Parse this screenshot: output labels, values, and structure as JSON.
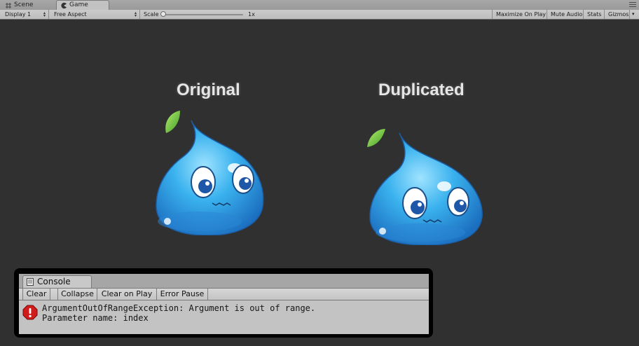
{
  "tabs": [
    {
      "label": "Scene",
      "icon": "grid-icon"
    },
    {
      "label": "Game",
      "icon": "pacman-icon",
      "active": true
    }
  ],
  "toolbar": {
    "display": "Display 1",
    "aspect": "Free Aspect",
    "scale_label": "Scale",
    "scale_value": "1x",
    "maximize_on_play": "Maximize On Play",
    "mute_audio": "Mute Audio",
    "stats": "Stats",
    "gizmos": "Gizmos"
  },
  "game": {
    "original_label": "Original",
    "duplicated_label": "Duplicated"
  },
  "console": {
    "tab_label": "Console",
    "buttons": [
      "Clear",
      "Collapse",
      "Clear on Play",
      "Error Pause"
    ],
    "error": {
      "line1": "ArgumentOutOfRangeException: Argument is out of range.",
      "line2": "Parameter name: index",
      "icon": "error-icon"
    }
  },
  "colors": {
    "background": "#303030",
    "toolbar": "#c2c2c2",
    "error_red": "#d01c1c",
    "slime_blue": "#3aa3e6",
    "leaf_green": "#6cc43a"
  }
}
